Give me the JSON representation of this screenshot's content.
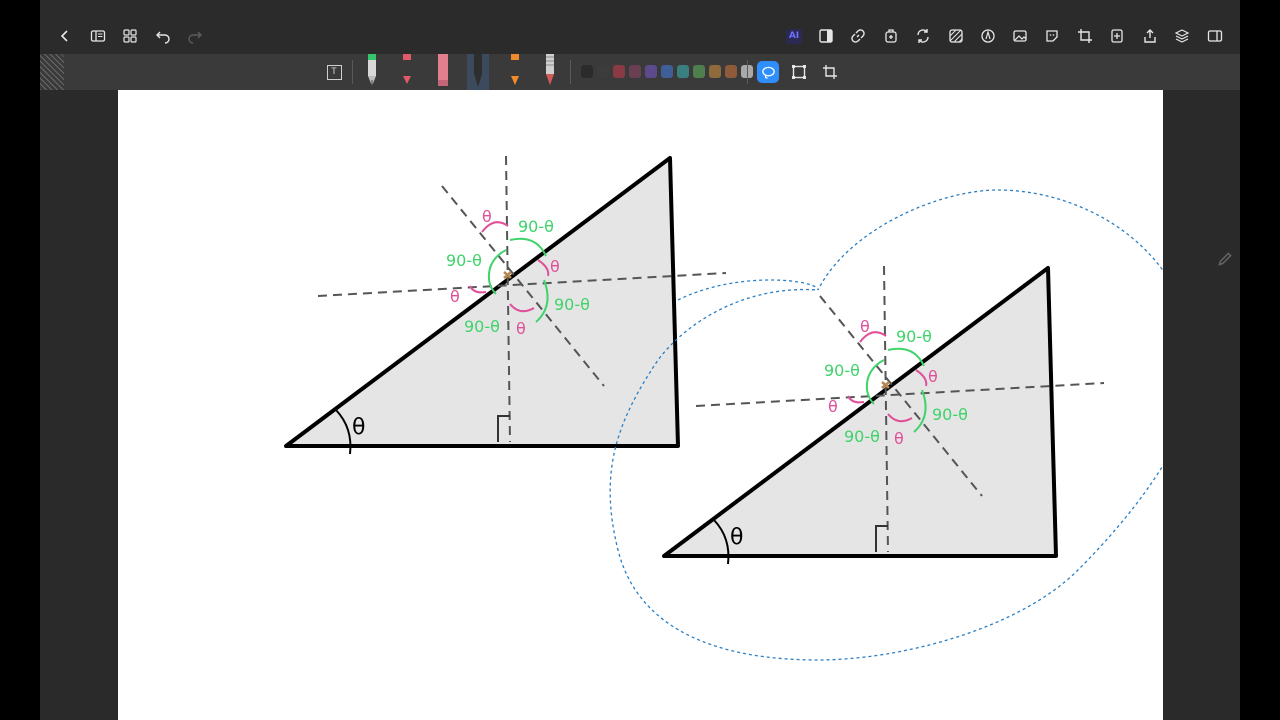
{
  "toolbar": {
    "ai_label": "AI",
    "text_tool_label": "T"
  },
  "colors": {
    "accent": "#2f8fff",
    "ai": "#5b5bf5",
    "theta_pink": "#e0509a",
    "angle_green": "#3fd36a",
    "lasso_blue": "#2b7fc4",
    "triangle_fill": "#e5e5e5",
    "swatches": [
      "#2b2b2b",
      "#3c3c3c",
      "#8a3a44",
      "#6a3f52",
      "#5c4a8c",
      "#3f5f99",
      "#3a7f7f",
      "#4f7f4f",
      "#8f6a3a",
      "#8f5a3a",
      "#a9a9a9"
    ]
  },
  "icons": {
    "top_left": [
      "back-chevron-icon",
      "sidebar-icon",
      "grid-icon",
      "undo-icon",
      "redo-icon"
    ],
    "top_right": [
      "ai-icon",
      "panel-toggle-icon",
      "link-icon",
      "add-page-icon",
      "refresh-icon",
      "pattern-icon",
      "pen-circle-icon",
      "image-icon",
      "sticker-icon",
      "crop-icon",
      "new-page-icon",
      "share-icon",
      "layers-icon",
      "split-view-icon"
    ]
  },
  "drawing": {
    "theta": "θ",
    "ninety_minus_theta": "90-θ"
  }
}
